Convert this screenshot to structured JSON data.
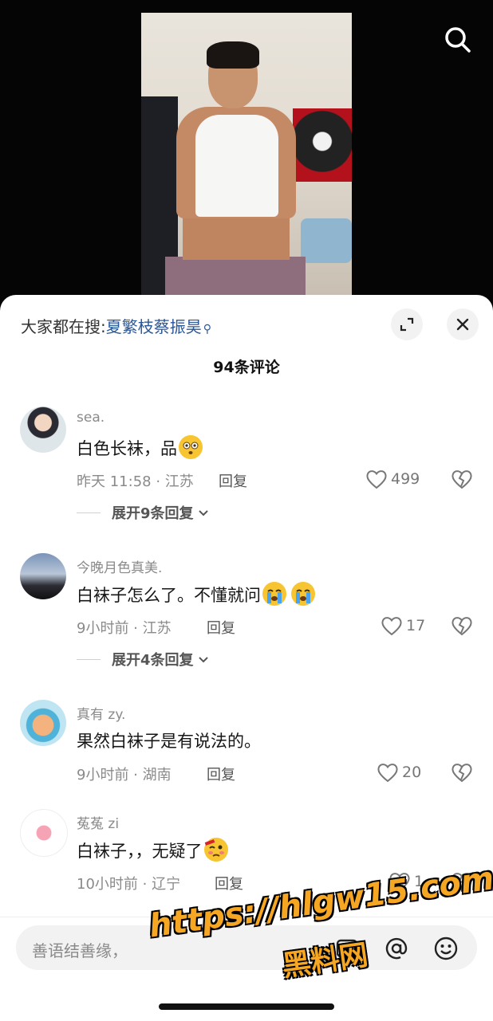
{
  "header": {
    "search_icon": "search-icon"
  },
  "trending": {
    "prefix": "大家都在搜:",
    "topic": "夏繁枝蔡振昊"
  },
  "comment_count": "94条评论",
  "comments": [
    {
      "username": "sea.",
      "text": "白色长袜，品",
      "emoji": "flushed-face",
      "time": "昨天 11:58",
      "location": "江苏",
      "reply": "回复",
      "likes": "499",
      "expand": "展开9条回复"
    },
    {
      "username": "今晚月色真美.",
      "text": "白袜子怎么了。不懂就问",
      "emoji": "crying-face",
      "time": "9小时前",
      "location": "江苏",
      "reply": "回复",
      "likes": "17",
      "expand": "展开4条回复"
    },
    {
      "username": "真有 zy.",
      "text": "果然白袜子是有说法的。",
      "time": "9小时前",
      "location": "湖南",
      "reply": "回复",
      "likes": "20"
    },
    {
      "username": "菟菟 zi",
      "text": "白袜子，，无疑了",
      "emoji": "woozy-face",
      "time": "10小时前",
      "location": "辽宁",
      "reply": "回复",
      "likes": "1"
    }
  ],
  "input": {
    "placeholder": "善语结善缘，"
  },
  "watermark": {
    "url": "https://hlgw15.com",
    "name": "黑料网"
  },
  "colors": {
    "topic": "#2b5797",
    "accent": "#f5a623"
  }
}
